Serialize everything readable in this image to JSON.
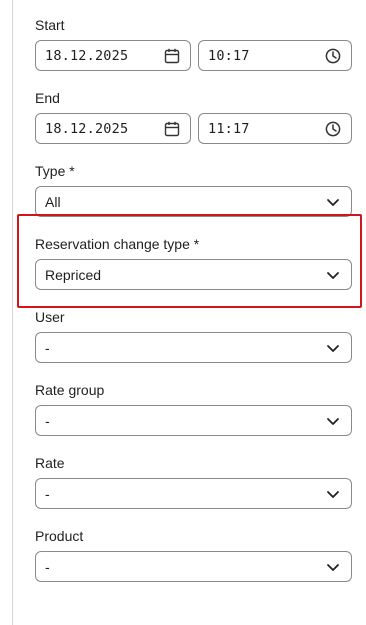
{
  "start": {
    "label": "Start",
    "date": "18.12.2025",
    "time": "10:17",
    "date_icon": "calendar-icon",
    "time_icon": "clock-icon"
  },
  "end": {
    "label": "End",
    "date": "18.12.2025",
    "time": "11:17",
    "date_icon": "calendar-icon",
    "time_icon": "clock-icon"
  },
  "type": {
    "label": "Type *",
    "value": "All"
  },
  "reservation_change_type": {
    "label": "Reservation change type *",
    "value": "Repriced"
  },
  "user": {
    "label": "User",
    "value": "-"
  },
  "rate_group": {
    "label": "Rate group",
    "value": "-"
  },
  "rate": {
    "label": "Rate",
    "value": "-"
  },
  "product": {
    "label": "Product",
    "value": "-"
  },
  "colors": {
    "highlight": "#d0161b",
    "border": "#8a8a8a",
    "text": "#1f1f1f"
  },
  "icons": {
    "select": "chevron-down-icon"
  }
}
